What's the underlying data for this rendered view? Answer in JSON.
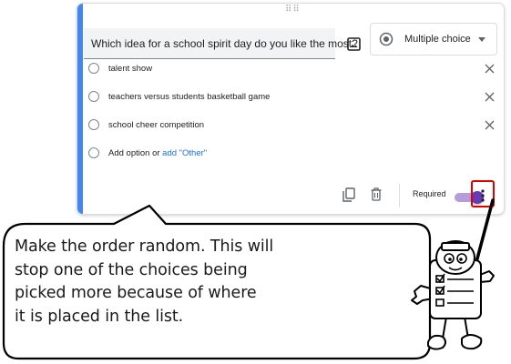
{
  "question": {
    "title": "Which idea for a school spirit day do you like the most?",
    "type_label": "Multiple choice"
  },
  "options": [
    {
      "label": "talent show"
    },
    {
      "label": "teachers versus students basketball game"
    },
    {
      "label": "school cheer competition"
    }
  ],
  "add_option": {
    "prefix": "Add option or ",
    "link": "add \"Other\""
  },
  "footer": {
    "required_label": "Required",
    "required_on": true
  },
  "callout": {
    "lines": [
      "Make the order random. This will",
      "stop one of the choices being",
      "picked more because of where",
      "it is placed in the list."
    ]
  },
  "colors": {
    "accent": "#4285f4",
    "toggle": "#673ab7",
    "highlight": "#e00000",
    "link": "#1a73e8"
  },
  "icons": [
    "drag-handle-icon",
    "image-icon",
    "radio-icon",
    "dropdown-caret-icon",
    "close-icon",
    "duplicate-icon",
    "trash-icon",
    "more-vert-icon"
  ]
}
